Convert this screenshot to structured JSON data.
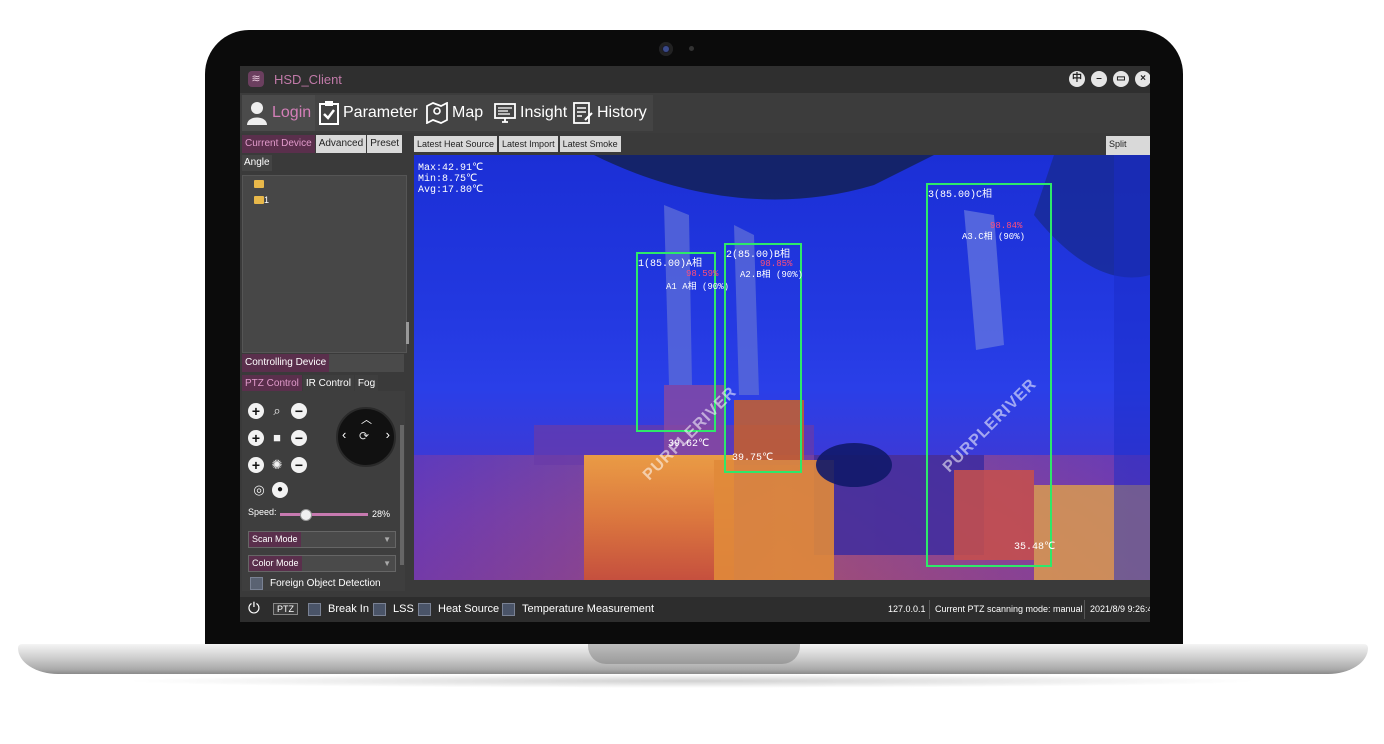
{
  "window": {
    "title": "HSD_Client",
    "controls": [
      "中",
      "–",
      "▭",
      "×"
    ]
  },
  "nav": {
    "items": [
      {
        "label": "Login",
        "icon": "user-icon"
      },
      {
        "label": "Parameter",
        "icon": "clipboard-check-icon"
      },
      {
        "label": "Map",
        "icon": "map-icon"
      },
      {
        "label": "Insight",
        "icon": "monitor-icon"
      },
      {
        "label": "History",
        "icon": "history-doc-icon"
      }
    ]
  },
  "device_tabs": [
    "Current Device",
    "Advanced",
    "Preset"
  ],
  "angle_label": "Angle",
  "tree": {
    "child_label": "1"
  },
  "controlling_device": "Controlling Device",
  "control_tabs": [
    "PTZ Control",
    "IR Control",
    "Fog"
  ],
  "speed": {
    "label": "Speed:",
    "value_text": "28%",
    "value": 0.28
  },
  "scan_mode": "Scan Mode",
  "color_mode": "Color Mode",
  "foreign_object": "Foreign Object Detection",
  "video_tabs": [
    "Latest Heat Source",
    "Latest Import",
    "Latest Smoke"
  ],
  "split_screen": "Split Screen",
  "hud": {
    "max": "Max:42.91℃",
    "min": "Min:8.75℃",
    "avg": "Avg:17.80℃"
  },
  "detections": [
    {
      "label": "1(85.00)A相",
      "pct": "98.59%",
      "sub": "A1 A相 (90%)",
      "temp": "39.62℃"
    },
    {
      "label": "2(85.00)B相",
      "pct": "98.85%",
      "sub": "A2.B相 (90%)",
      "temp": "39.75℃"
    },
    {
      "label": "3(85.00)C相",
      "pct": "98.84%",
      "sub": "A3.C相 (90%)",
      "temp": "35.48℃"
    }
  ],
  "watermark": "PURPLERIVER",
  "status": {
    "ptz": "PTZ",
    "break_in": "Break In",
    "lss": "LSS",
    "heat_source": "Heat Source",
    "temperature": "Temperature Measurement",
    "ip": "127.0.0.1",
    "scan_mode_text": "Current PTZ scanning mode: manual",
    "datetime": "2021/8/9 9:26:4"
  },
  "colors": {
    "accent": "#c07aa8",
    "tab_active": "#5a2f4c",
    "detection_box": "#2ee86a",
    "thermal_cold": "#1b2fd6",
    "thermal_hot": "#f6a33a"
  }
}
